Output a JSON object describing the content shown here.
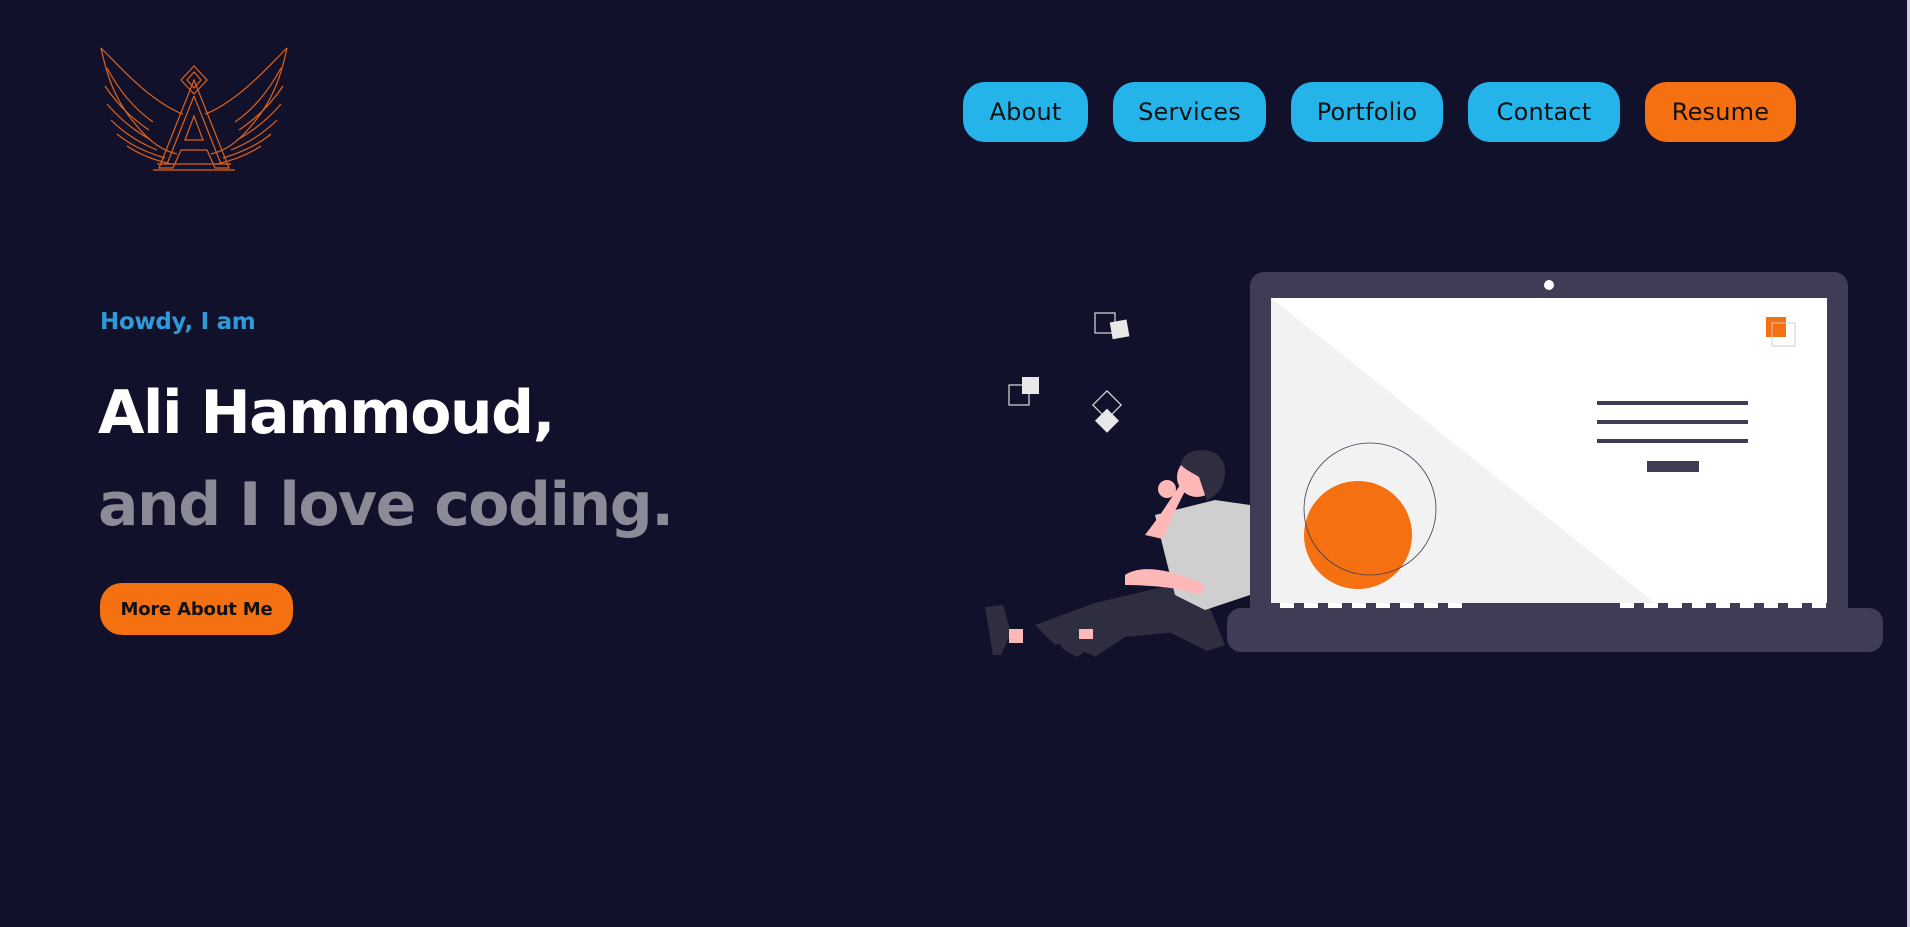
{
  "nav": {
    "about": "About",
    "services": "Services",
    "portfolio": "Portfolio",
    "contact": "Contact",
    "resume": "Resume"
  },
  "hero": {
    "greeting": "Howdy, I am",
    "name": "Ali Hammoud,",
    "tagline": "and I love coding.",
    "cta": "More About Me"
  },
  "colors": {
    "background": "#11112b",
    "nav_button": "#24b4ea",
    "accent": "#f47011",
    "greeting": "#2e9bd8",
    "tagline": "#8b8a97"
  },
  "icons": {
    "logo": "winged-a-logo",
    "illustration": "person-with-laptop-illustration"
  }
}
